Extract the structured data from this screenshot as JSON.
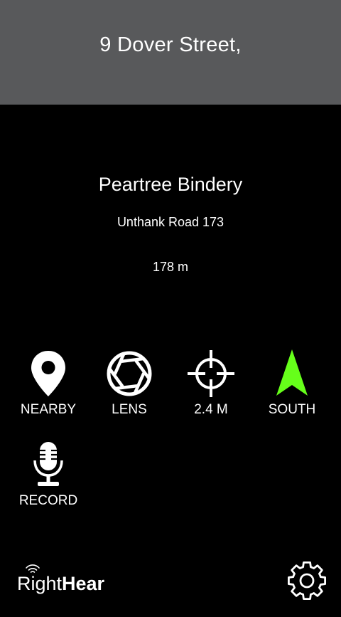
{
  "header": {
    "title": "9 Dover Street,"
  },
  "place": {
    "name": "Peartree Bindery",
    "address": "Unthank Road 173",
    "distance": "178 m"
  },
  "actions": [
    {
      "label": "NEARBY",
      "icon": "location-pin-icon"
    },
    {
      "label": "LENS",
      "icon": "camera-aperture-icon"
    },
    {
      "label": "2.4 M",
      "icon": "crosshair-icon"
    },
    {
      "label": "SOUTH",
      "icon": "direction-arrow-icon",
      "color": "#66ff1a"
    },
    {
      "label": "RECORD",
      "icon": "microphone-icon"
    }
  ],
  "logo": {
    "part1": "Right",
    "part2": "Hear"
  },
  "settings": {
    "icon": "gear-icon"
  },
  "colors": {
    "background": "#000000",
    "header_background": "#58595b",
    "text": "#ffffff",
    "accent": "#66ff1a"
  }
}
